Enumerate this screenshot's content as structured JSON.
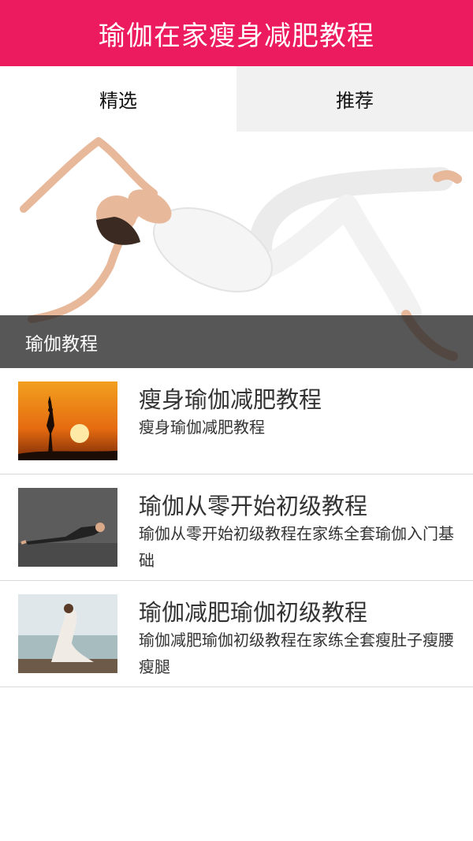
{
  "app": {
    "title": "瑜伽在家瘦身减肥教程"
  },
  "tabs": [
    {
      "label": "精选",
      "active": true
    },
    {
      "label": "推荐",
      "active": false
    }
  ],
  "banner": {
    "caption": "瑜伽教程"
  },
  "items": [
    {
      "title": "瘦身瑜伽减肥教程",
      "desc": "瘦身瑜伽减肥教程"
    },
    {
      "title": "瑜伽从零开始初级教程",
      "desc": "瑜伽从零开始初级教程在家练全套瑜伽入门基础"
    },
    {
      "title": "瑜伽减肥瑜伽初级教程",
      "desc": "瑜伽减肥瑜伽初级教程在家练全套瘦肚子瘦腰瘦腿"
    }
  ],
  "colors": {
    "accent": "#ec1a5f",
    "tab_inactive_bg": "#f1f1f1"
  }
}
